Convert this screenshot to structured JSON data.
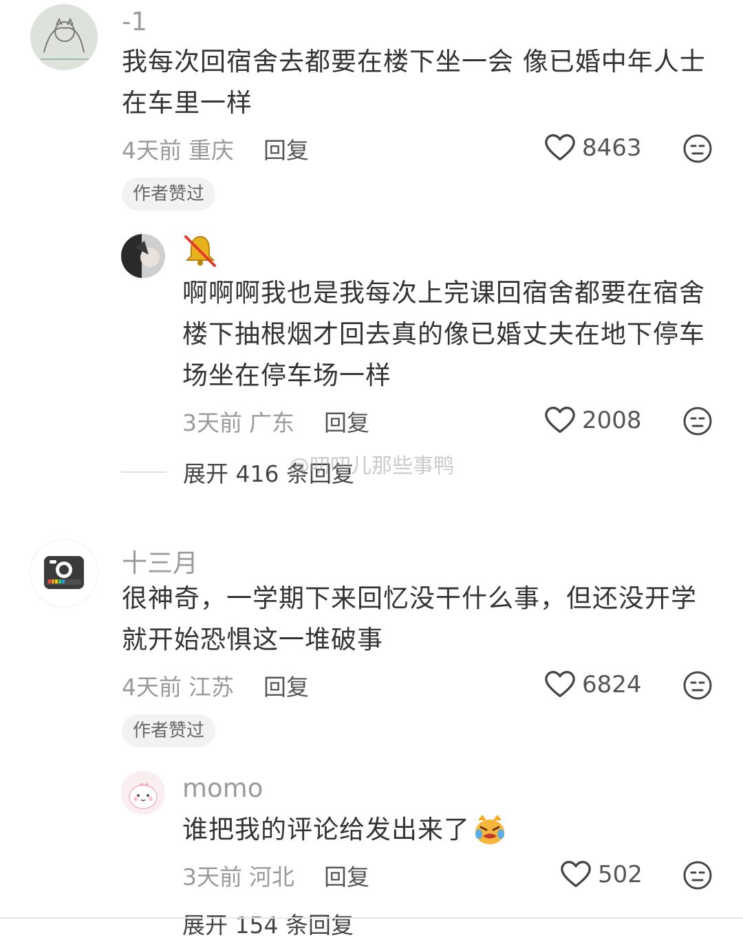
{
  "comments": [
    {
      "nickname": "-1",
      "text": "我每次回宿舍去都要在楼下坐一会 像已婚中年人士在车里一样",
      "time": "4天前",
      "location": "重庆",
      "reply_label": "回复",
      "likes": "8463",
      "badge": "作者赞过"
    },
    {
      "nickname": "",
      "text": "啊啊啊我也是我每次上完课回宿舍都要在宿舍楼下抽根烟才回去真的像已婚丈夫在地下停车场坐在停车场一样",
      "time": "3天前",
      "location": "广东",
      "reply_label": "回复",
      "likes": "2008",
      "expand_label": "展开 416 条回复"
    },
    {
      "nickname": "十三月",
      "text": "很神奇，一学期下来回忆没干什么事，但还没开学就开始恐惧这一堆破事",
      "time": "4天前",
      "location": "江苏",
      "reply_label": "回复",
      "likes": "6824",
      "badge": "作者赞过"
    },
    {
      "nickname": "momo",
      "text": "谁把我的评论给发出来了",
      "time": "3天前",
      "location": "河北",
      "reply_label": "回复",
      "likes": "502",
      "expand_label": "展开 154 条回复"
    }
  ],
  "watermark": "@叨叨儿那些事鸭",
  "icons": {
    "like": "heart-outline-icon",
    "dislike": "meh-face-icon",
    "mute": "muted-bell-icon",
    "emoji": "crying-cat-emoji"
  },
  "colors": {
    "text": "#333333",
    "muted": "#9a9a9a",
    "badge_bg": "#f2f2f2"
  }
}
